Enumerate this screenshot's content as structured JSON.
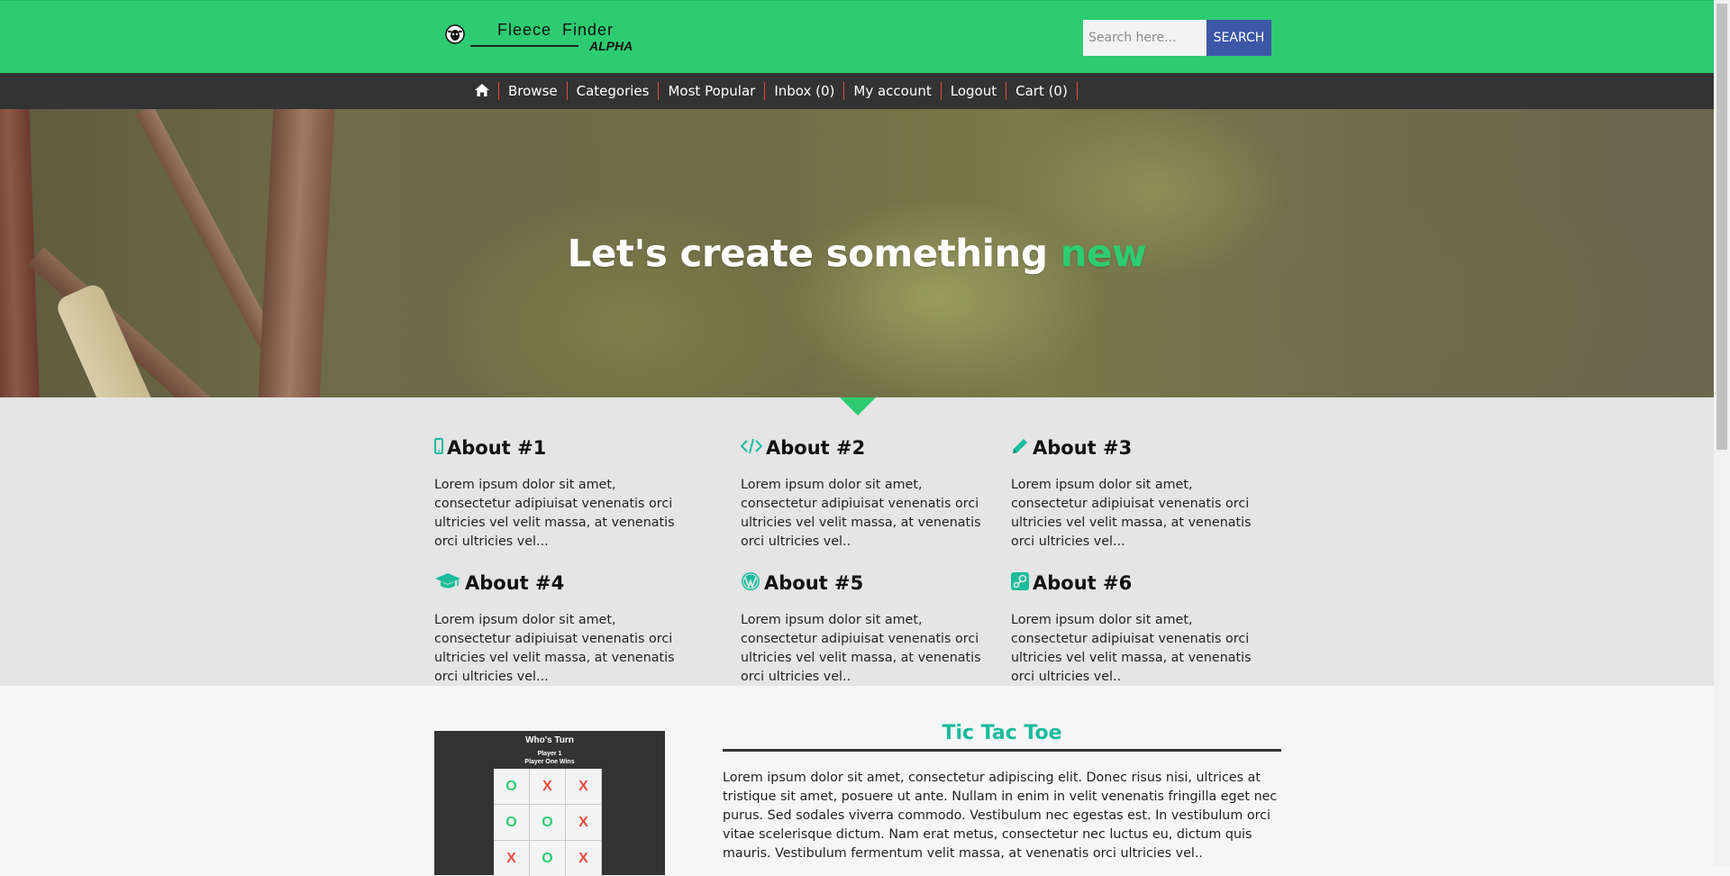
{
  "header": {
    "brand": "Fleece Finder",
    "badge": "ALPHA",
    "search_placeholder": "Search here...",
    "search_button": "SEARCH"
  },
  "nav": {
    "home_icon": "home-icon",
    "items": [
      "Browse",
      "Categories",
      "Most Popular",
      "Inbox (0)",
      "My account",
      "Logout",
      "Cart (0)"
    ]
  },
  "hero": {
    "title_main": "Let's create something",
    "title_accent": "new"
  },
  "about": [
    {
      "icon": "mobile-icon",
      "title": "About #1",
      "text": "Lorem ipsum dolor sit amet, consectetur adipiuisat venenatis orci ultricies vel velit massa, at venenatis orci ultricies vel..."
    },
    {
      "icon": "code-icon",
      "title": "About #2",
      "text": "Lorem ipsum dolor sit amet, consectetur adipiuisat venenatis orci ultricies vel velit massa, at venenatis orci ultricies vel.."
    },
    {
      "icon": "pencil-icon",
      "title": "About #3",
      "text": "Lorem ipsum dolor sit amet, consectetur adipiuisat venenatis orci ultricies vel velit massa, at venenatis orci ultricies vel..."
    },
    {
      "icon": "graduation-cap-icon",
      "title": "About #4",
      "text": "Lorem ipsum dolor sit amet, consectetur adipiuisat venenatis orci ultricies vel velit massa, at venenatis orci ultricies vel..."
    },
    {
      "icon": "wordpress-icon",
      "title": "About #5",
      "text": "Lorem ipsum dolor sit amet, consectetur adipiuisat venenatis orci ultricies vel velit massa, at venenatis orci ultricies vel.."
    },
    {
      "icon": "steam-icon",
      "title": "About #6",
      "text": "Lorem ipsum dolor sit amet, consectetur adipiuisat venenatis orci ultricies vel velit massa, at venenatis orci ultricies vel.."
    }
  ],
  "game_preview": {
    "heading": "Who's Turn",
    "player": "Player 1",
    "status": "Player One Wins",
    "board": [
      "O",
      "X",
      "X",
      "O",
      "O",
      "X",
      "X",
      "O",
      "X"
    ]
  },
  "tictactoe": {
    "title": "Tic Tac Toe",
    "text": "Lorem ipsum dolor sit amet, consectetur adipiscing elit. Donec risus nisi, ultrices at tristique sit amet, posuere ut ante. Nullam in enim in velit venenatis fringilla eget nec purus. Sed sodales viverra commodo. Vestibulum nec egestas est. In vestibulum orci vitae scelerisque dictum. Nam erat metus, consectetur nec luctus eu, dictum quis mauris. Vestibulum fermentum velit massa, at venenatis orci ultricies vel.."
  },
  "colors": {
    "brand_green": "#2ecc71",
    "nav_dark": "#333333",
    "nav_divider": "#e74c3c",
    "search_blue": "#3b57a6",
    "teal": "#1abc9c"
  }
}
